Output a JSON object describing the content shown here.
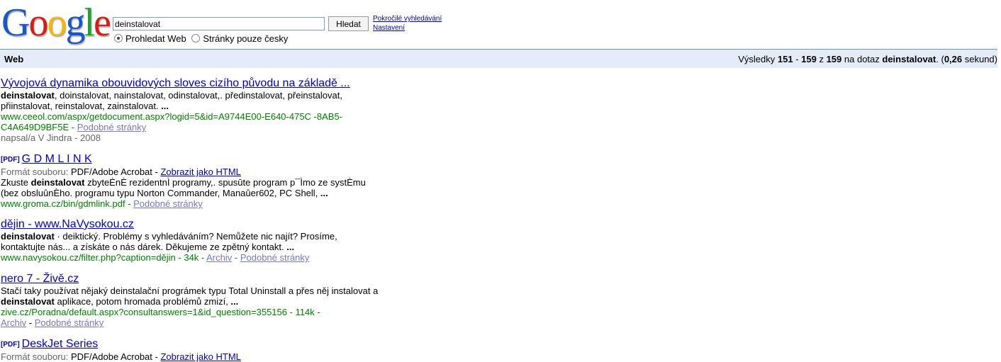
{
  "logo": {
    "text": "Google",
    "letters": [
      "G",
      "o",
      "o",
      "g",
      "l",
      "e"
    ],
    "colors": [
      "#1a57c7",
      "#d51e1a",
      "#f5b50a",
      "#1a57c7",
      "#21a32e",
      "#d51e1a"
    ]
  },
  "search": {
    "value": "deinstalovat",
    "button_label": "Hledat"
  },
  "advanced_links": {
    "advanced": "Pokročilé vyhledávání",
    "settings": "Nastavení"
  },
  "radios": {
    "web": "Prohledat Web",
    "czech": "Stránky pouze česky"
  },
  "results_bar": {
    "tab": "Web",
    "prefix": "Výsledky ",
    "from": "151",
    "dash": " - ",
    "to": "159",
    "of": " z ",
    "total": "159",
    "query_text": " na dotaz ",
    "query": "deinstalovat",
    "time_open": ". (",
    "time": "0,26",
    "time_close": " sekund)"
  },
  "results": [
    {
      "title": "Vývojová dynamika obouvidových sloves cizího původu na základě ...",
      "snippet_bold": "deinstalovat",
      "snippet_1": ", doinstalovat, nainstalovat, odinstalovat,. předinstalovat, přeinstalovat,",
      "snippet_2": "přiinstalovat, reinstalovat, zainstalovat. ",
      "ellipsis": "...",
      "url_1": "www.ceeol.com/aspx/getdocument.aspx?logid=5&id=A9744E00-E640-475C -8AB5-",
      "url_2": "C4A649D9BF5E",
      "sep": " - ",
      "similar": "Podobné stránky",
      "author": "napsal/a V Jindra",
      "year": "2008"
    },
    {
      "pdf": "[PDF]",
      "title": "G D M L I N K",
      "format_label": "Formát souboru: ",
      "format": "PDF/Adobe Acrobat",
      "sep": " - ",
      "html_link": "Zobrazit jako HTML",
      "snippet_pre": "Zkuste ",
      "snippet_bold": "deinstalovat",
      "snippet_1": " zbyteĖnĖ rezidentnÌ programy,. spusūte program p¯Ìmo ze systÈmu",
      "snippet_2": "(bez obsluûnÈho. programu typu Norton Commander, Manaûer602, PC Shell, ",
      "ellipsis": "...",
      "url": "www.groma.cz/bin/gdmlink.pdf",
      "similar": "Podobné stránky"
    },
    {
      "title": "dějin - www.NaVysokou.cz",
      "snippet_bold": "deinstalovat",
      "snippet_1": " · deiktický. Problémy s vyhledáváním? Nemůžete nic najít? Prosíme,",
      "snippet_2": "kontaktujte nás... a získáte o nás dárek. Děkujeme ze zpětný kontakt. ",
      "ellipsis": "...",
      "url": "www.navysokou.cz/filter.php?caption=dějin - 34k",
      "sep": " - ",
      "archive": "Archiv",
      "similar": "Podobné stránky"
    },
    {
      "title": "nero 7 - Živě.cz",
      "snippet_1": "Stačí taky používat nějaký deinstalační prográmek typu Total Uninstall a přes něj instalovat a",
      "snippet_bold": "deinstalovat",
      "snippet_2": " aplikace, potom hromada problémů zmizí, ",
      "ellipsis": "...",
      "url": "zive.cz/Poradna/default.aspx?consultanswers=1&id_question=355156 - 114k -",
      "sep": " - ",
      "archive": "Archiv",
      "similar": "Podobné stránky"
    },
    {
      "pdf": "[PDF]",
      "title": "DeskJet Series",
      "format_label": "Formát souboru: ",
      "format": "PDF/Adobe Acrobat",
      "sep": " - ",
      "html_link": "Zobrazit jako HTML"
    }
  ]
}
